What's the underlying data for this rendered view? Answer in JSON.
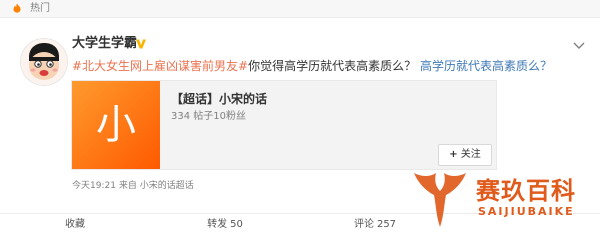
{
  "header": {
    "hot_label": "热门",
    "hot_icon": "flame-icon"
  },
  "post": {
    "author": "大学生学霸",
    "verified_icon": "verified-badge-icon",
    "hashtag": "#北大女生网上雇凶谋害前男友#",
    "body": "你觉得高学历就代表高素质么？",
    "link_text": "高学历就代表高素质么？",
    "menu_icon": "chevron-down-icon"
  },
  "card": {
    "thumb_char": "小",
    "title": "【超话】小宋的话",
    "subtitle": "334 帖子10粉丝",
    "follow_label": "关注",
    "follow_icon": "plus-icon"
  },
  "meta": {
    "time": "今天19:21",
    "source_prefix": "来自",
    "source": "小宋的话超话"
  },
  "actions": [
    {
      "label": "收藏",
      "count": ""
    },
    {
      "label": "转发",
      "count": "50"
    },
    {
      "label": "评论",
      "count": "257"
    },
    {
      "label": "",
      "count": ""
    }
  ],
  "watermark": {
    "title": "赛玖百科",
    "subtitle": "SAIJIUBAIKE"
  },
  "colors": {
    "accent": "#eb7350",
    "link": "#3f78b7",
    "card_thumb": "#ff6a00",
    "watermark": "#e05a1b"
  }
}
